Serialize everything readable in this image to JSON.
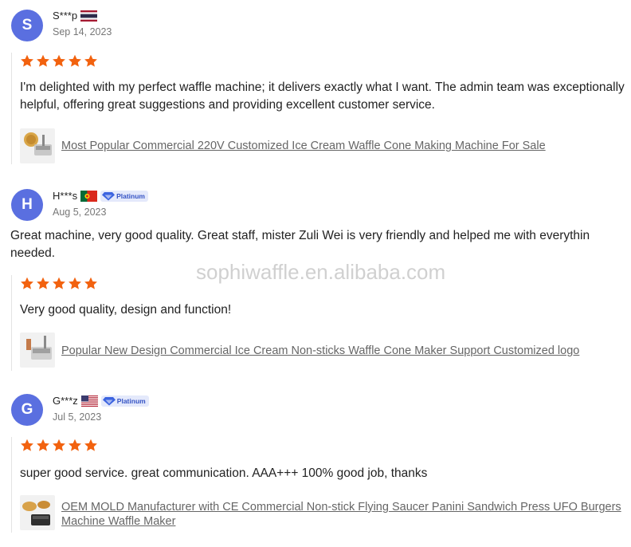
{
  "colors": {
    "avatar": "#5a6fe0",
    "star": "#f2620f",
    "badge_text": "#3553c4",
    "badge_bg": "#e4e9fb"
  },
  "watermark": "sophiwaffle.en.alibaba.com",
  "reviews": [
    {
      "avatar_letter": "S",
      "username": "S***p",
      "flag_icon": "thailand-flag-icon",
      "badge": "",
      "date": "Sep 14, 2023",
      "followup": "",
      "rating": 5,
      "text": "I'm delighted with my perfect waffle machine; it delivers exactly what I want. The admin team was exceptionally helpful, offering great suggestions and providing excellent customer service.",
      "product_link": "Most Popular Commercial 220V Customized Ice Cream Waffle Cone Making Machine For Sale"
    },
    {
      "avatar_letter": "H",
      "username": "H***s",
      "flag_icon": "portugal-flag-icon",
      "badge": "Platinum",
      "date": "Aug 5, 2023",
      "followup": "Great machine, very good quality. Great staff, mister Zuli Wei is very friendly and helped me with everythin",
      "followup_line2": "needed.",
      "rating": 5,
      "text": "Very good quality, design and function!",
      "product_link": "Popular New Design Commercial Ice Cream Non-sticks Waffle Cone Maker Support Customized logo"
    },
    {
      "avatar_letter": "G",
      "username": "G***z",
      "flag_icon": "usa-flag-icon",
      "badge": "Platinum",
      "date": "Jul 5, 2023",
      "followup": "",
      "rating": 5,
      "text": "super good service. great communication. AAA+++ 100% good job, thanks",
      "product_link": "OEM MOLD Manufacturer with CE Commercial Non-stick Flying Saucer Panini Sandwich Press UFO Burgers Machine Waffle Maker"
    }
  ]
}
